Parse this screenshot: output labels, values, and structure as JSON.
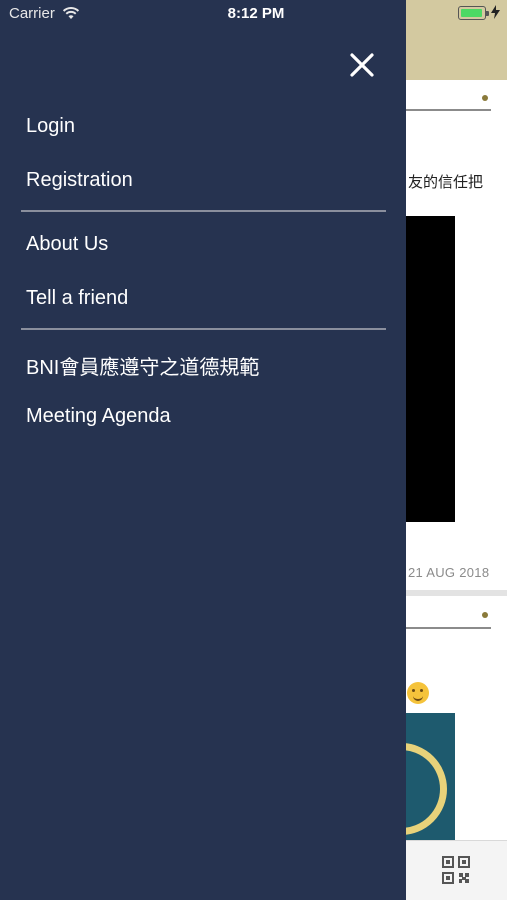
{
  "status_bar": {
    "carrier": "Carrier",
    "time": "8:12 PM"
  },
  "background_feed": {
    "post1_text_fragment": "友的信任把",
    "post1_date": "21 AUG 2018"
  },
  "drawer": {
    "close_icon": "close-icon",
    "groups": [
      {
        "items": [
          {
            "label": "Login"
          },
          {
            "label": "Registration"
          }
        ]
      },
      {
        "items": [
          {
            "label": "About Us"
          },
          {
            "label": "Tell a friend"
          }
        ]
      },
      {
        "items": [
          {
            "label": "BNI會員應遵守之道德規範"
          },
          {
            "label": "Meeting Agenda"
          }
        ]
      }
    ]
  },
  "tab_bar": {
    "qr_icon": "qr-code-icon"
  },
  "colors": {
    "drawer_bg": "#263350",
    "header_bg": "#d3c9a0",
    "battery_green": "#4cd964"
  }
}
